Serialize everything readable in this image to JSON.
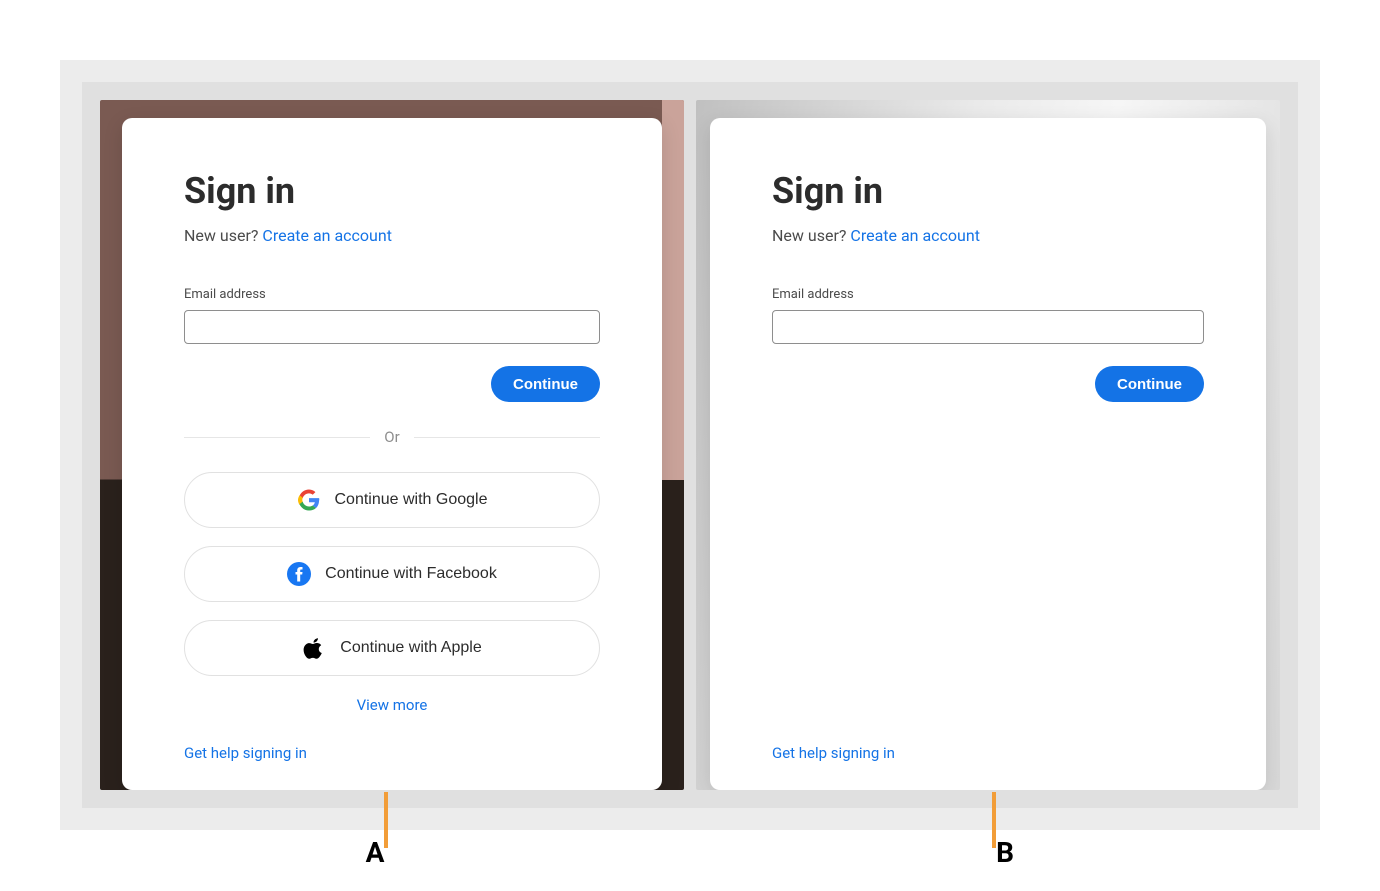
{
  "figure": {
    "labels": {
      "a": "A",
      "b": "B"
    }
  },
  "panel_a": {
    "title": "Sign in",
    "new_user_text": "New user? ",
    "create_account_link": "Create an account",
    "email_label": "Email address",
    "email_value": "",
    "continue_label": "Continue",
    "divider_text": "Or",
    "sso": {
      "google": "Continue with Google",
      "facebook": "Continue with Facebook",
      "apple": "Continue with Apple"
    },
    "view_more_label": "View more",
    "help_link": "Get help signing in"
  },
  "panel_b": {
    "title": "Sign in",
    "new_user_text": "New user? ",
    "create_account_link": "Create an account",
    "email_label": "Email address",
    "email_value": "",
    "continue_label": "Continue",
    "help_link": "Get help signing in"
  },
  "colors": {
    "accent": "#1473e6",
    "callout": "#f29d38"
  }
}
